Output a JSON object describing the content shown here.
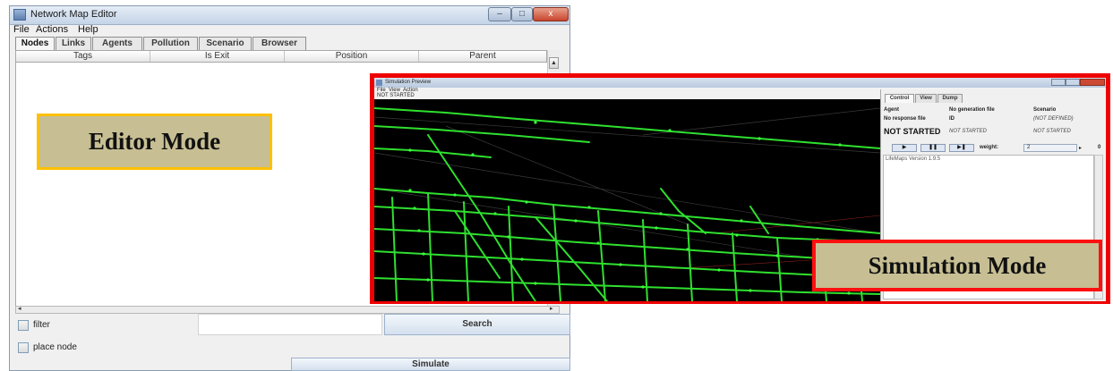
{
  "editor": {
    "title": "Network Map Editor",
    "window_buttons": [
      "–",
      "□",
      "x"
    ],
    "menu": [
      "File",
      "Actions",
      "Help"
    ],
    "tabs": [
      "Nodes",
      "Links",
      "Agents",
      "Pollution",
      "Scenario",
      "Browser"
    ],
    "active_tab": "Nodes",
    "columns": [
      "Tags",
      "Is Exit",
      "Position",
      "Parent"
    ],
    "filter_label": "filter",
    "search_label": "Search",
    "place_node_label": "place node",
    "simulate_label": "Simulate"
  },
  "editor_mode_label": "Editor Mode",
  "simulation": {
    "title": "Simulation Preview",
    "menu": [
      "File",
      "View",
      "Action"
    ],
    "status": "NOT STARTED",
    "panel_tabs": [
      "Control",
      "View",
      "Dump"
    ],
    "active_panel_tab": "Control",
    "fields": {
      "agent": "Agent",
      "no_generation_file": "No generation file",
      "scenario": "Scenario",
      "no_response_file": "No response file",
      "id": "ID",
      "not_defined": "(NOT DEFINED)",
      "not_started_big": "NOT STARTED",
      "not_started_italic_1": "NOT STARTED",
      "not_started_italic_2": "NOT STARTED"
    },
    "controls": {
      "play": "▶",
      "pause": "❚❚",
      "step": "▶❚",
      "weight_label": "weight:",
      "weight_value": "2",
      "slider_right": "▸",
      "counter": "0"
    },
    "log_text": "LifeMaps Version 1.9.5"
  },
  "simulation_mode_label": "Simulation Mode"
}
